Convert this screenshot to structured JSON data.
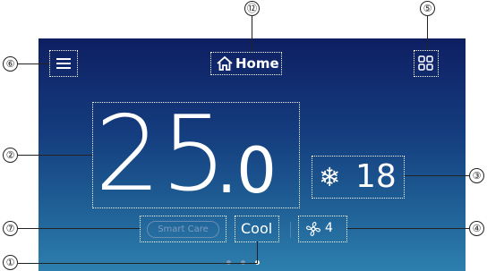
{
  "header": {
    "title": "Home"
  },
  "temperature": {
    "main": "25",
    "decimal": ".0"
  },
  "target": {
    "value": "18"
  },
  "modes": {
    "smart_care": "Smart Care",
    "operation": "Cool"
  },
  "fan": {
    "speed": "4"
  },
  "callouts": [
    "①",
    "②",
    "③",
    "④",
    "⑤",
    "⑥",
    "⑦",
    "⑫"
  ],
  "pager": {
    "count": 3,
    "active": 2
  },
  "icons": {
    "menu": "menu-icon",
    "home": "home-icon",
    "grid": "grid-icon",
    "snowflake": "snowflake-icon",
    "fan": "fan-icon"
  }
}
